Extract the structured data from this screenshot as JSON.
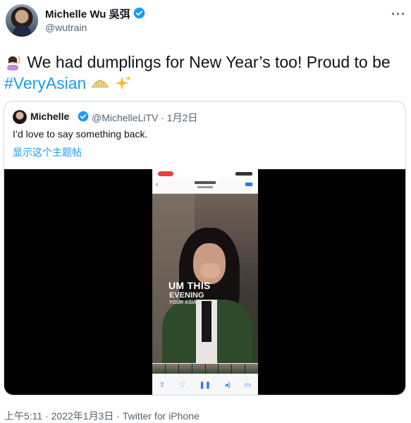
{
  "author": {
    "name": "Michelle Wu 吳弭",
    "handle": "@wutrain"
  },
  "tweet": {
    "text_main": "We had dumplings for New Year’s too! Proud to be",
    "hashtag": "#VeryAsian"
  },
  "quoted": {
    "name": "Michelle",
    "meta": "@MichelleLiTV · 1月2日",
    "text": "I’d love to say something back.",
    "show_thread": "显示这个主题帖",
    "video_caption_line1": "UM THIS",
    "video_caption_line2": "EVENING",
    "video_caption_line3": "YOUR ASIAN"
  },
  "footer": {
    "timestamp": "上午5:11 · 2022年1月3日 · Twitter for iPhone"
  },
  "icons": [
    "verified-badge-icon",
    "more-options-icon",
    "raising-hand-emoji-icon",
    "dumpling-emoji-icon",
    "sparkles-emoji-icon"
  ],
  "colors": {
    "link": "#1d9bf0",
    "secondary_text": "#536471",
    "primary_text": "#0f1419",
    "border": "#cfd9de"
  }
}
